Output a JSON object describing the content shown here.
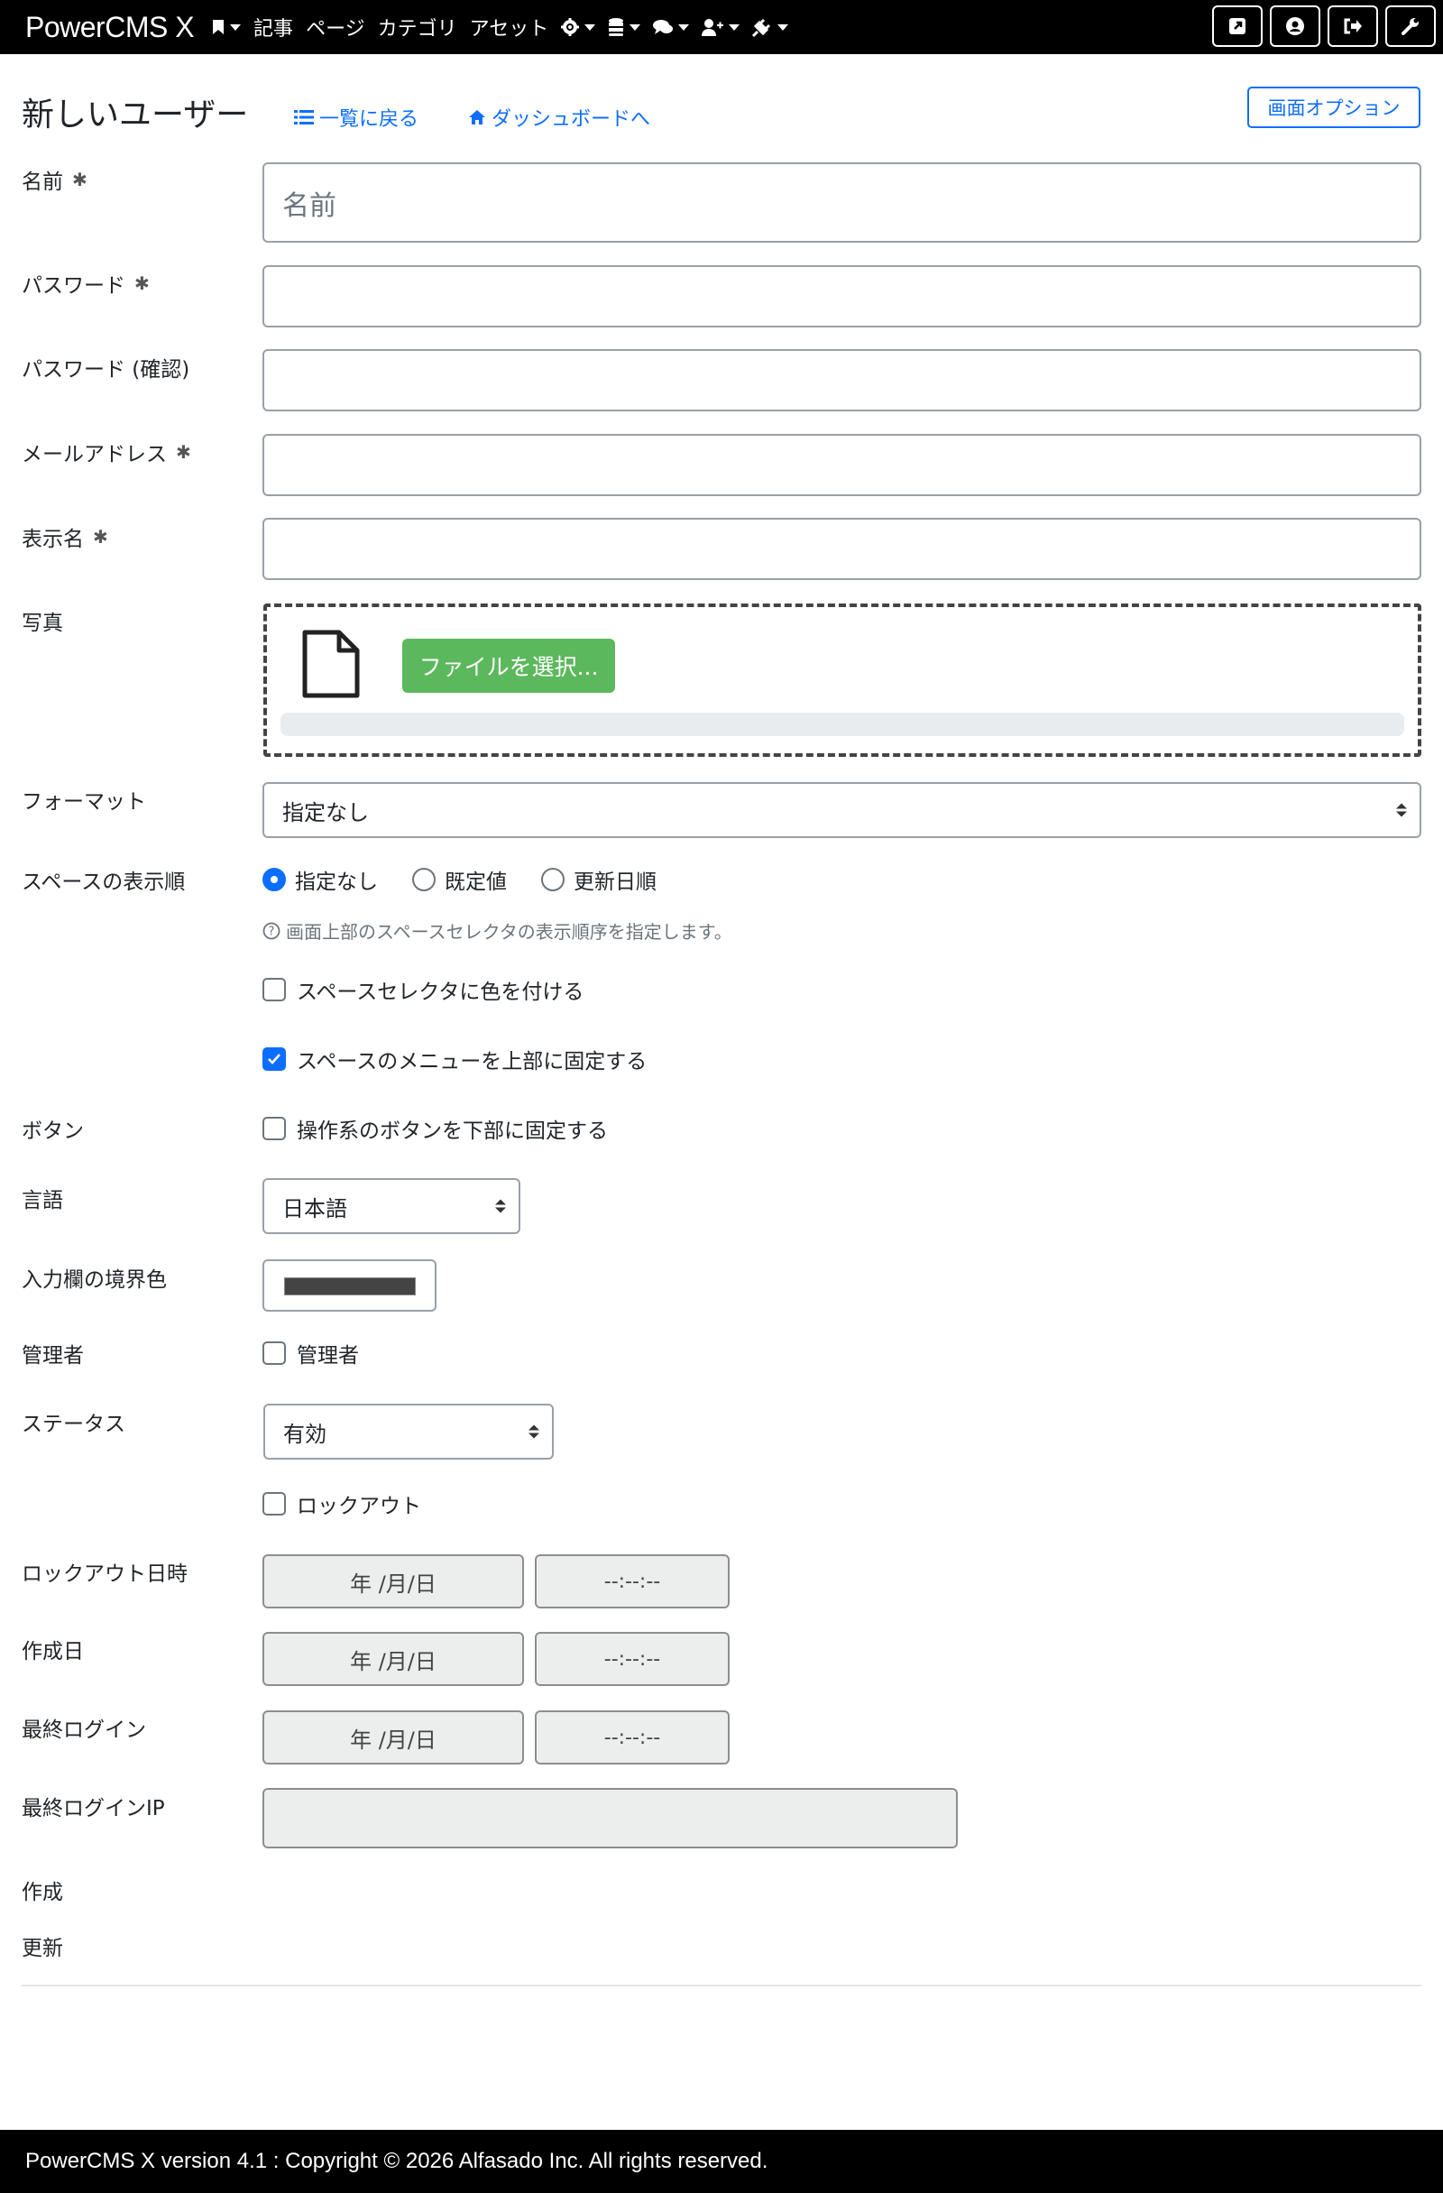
{
  "navbar": {
    "brand": "PowerCMS X",
    "menu_items": [
      "記事",
      "ページ",
      "カテゴリ",
      "アセット"
    ],
    "icons": [
      "bookmark-icon",
      "gear-icon",
      "database-icon",
      "comments-icon",
      "user-plus-icon",
      "plug-icon"
    ],
    "right_buttons": [
      "external-link-icon",
      "user-circle-icon",
      "sign-out-icon",
      "wrench-icon"
    ]
  },
  "header": {
    "title": "新しいユーザー",
    "back_link": "一覧に戻る",
    "dashboard_link": "ダッシュボードへ",
    "options_button": "画面オプション"
  },
  "form": {
    "name": {
      "label": "名前",
      "placeholder": "名前",
      "required": true
    },
    "password": {
      "label": "パスワード",
      "required": true
    },
    "password_confirm": {
      "label": "パスワード (確認)"
    },
    "email": {
      "label": "メールアドレス",
      "required": true
    },
    "display_name": {
      "label": "表示名",
      "required": true
    },
    "photo": {
      "label": "写真",
      "file_button": "ファイルを選択..."
    },
    "format": {
      "label": "フォーマット",
      "selected": "指定なし"
    },
    "space_order": {
      "label": "スペースの表示順",
      "options": [
        "指定なし",
        "既定値",
        "更新日順"
      ],
      "selected_index": 0,
      "help": "画面上部のスペースセレクタの表示順序を指定します。",
      "color_checkbox": "スペースセレクタに色を付ける",
      "color_checked": false,
      "fix_menu_checkbox": "スペースのメニューを上部に固定する",
      "fix_menu_checked": true
    },
    "buttons": {
      "label": "ボタン",
      "checkbox": "操作系のボタンを下部に固定する",
      "checked": false
    },
    "language": {
      "label": "言語",
      "selected": "日本語"
    },
    "border_color": {
      "label": "入力欄の境界色",
      "value": "#444444"
    },
    "admin": {
      "label": "管理者",
      "checkbox": "管理者",
      "checked": false
    },
    "status": {
      "label": "ステータス",
      "selected": "有効",
      "lockout_checkbox": "ロックアウト",
      "lockout_checked": false
    },
    "lockout_date": {
      "label": "ロックアウト日時",
      "date": "年 /月/日",
      "time": "--:--:--"
    },
    "created_date": {
      "label": "作成日",
      "date": "年 /月/日",
      "time": "--:--:--"
    },
    "last_login": {
      "label": "最終ログイン",
      "date": "年 /月/日",
      "time": "--:--:--"
    },
    "last_login_ip": {
      "label": "最終ログインIP"
    },
    "created_by": {
      "label": "作成"
    },
    "modified_by": {
      "label": "更新"
    }
  },
  "footer": {
    "text": "PowerCMS X version 4.1 : Copyright © 2026 Alfasado Inc. All rights reserved."
  },
  "colors": {
    "accent": "#0d6efd",
    "file_button": "#5cb85c",
    "navbar": "#000000"
  }
}
